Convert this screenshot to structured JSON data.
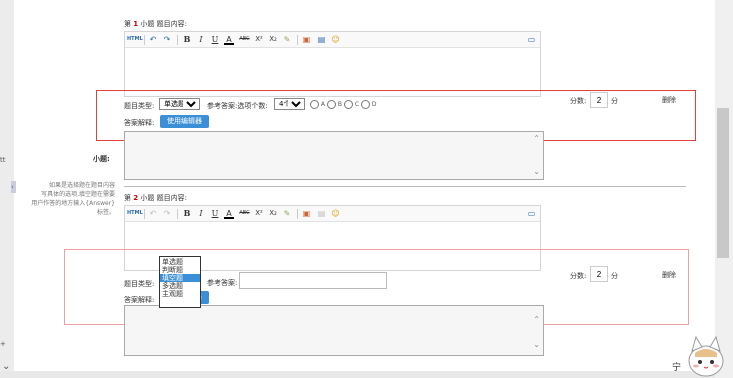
{
  "sidebar_stub": {
    "char1": "tt",
    "char2": "+",
    "expand_glyph": "‹",
    "scroll_glyph": "⌄"
  },
  "question1": {
    "header_prefix": "第",
    "header_num": "1",
    "header_suffix": "小题",
    "content_label": "题目内容:",
    "type_label": "题目类型:",
    "type_value": "单选题",
    "answer_label": "参考答案:选项个数:",
    "options_count": "4个",
    "options": [
      "A",
      "B",
      "C",
      "D"
    ],
    "score_label": "分数:",
    "score_value": "2",
    "score_unit": "分",
    "delete_label": "删除",
    "explain_label": "答案解释:",
    "editor_button": "使用编辑器",
    "subq_label": "小题:"
  },
  "hint_text": [
    "如果是选择题在题目内容",
    "写具体的选项,填空题在需要",
    "用户作答的地方输入{Answer}",
    "标签。"
  ],
  "question2": {
    "header_prefix": "第",
    "header_num": "2",
    "header_suffix": "小题",
    "content_label": "题目内容:",
    "type_label": "题目类型:",
    "answer_label": "参考答案:",
    "answer_value": "",
    "score_label": "分数:",
    "score_value": "2",
    "score_unit": "分",
    "delete_label": "删除",
    "explain_label": "答案解释:",
    "editor_button": "使用编辑器"
  },
  "dropdown": {
    "options": [
      "单选题",
      "判断题",
      "填空题",
      "多选题",
      "主观题"
    ],
    "selected": "填空题"
  },
  "toolbar": {
    "html": "HTML",
    "undo": "↶",
    "redo": "↷",
    "bold": "B",
    "italic": "I",
    "underline": "U",
    "font_color": "A",
    "strike": "ABC",
    "superscript": "X²",
    "subscript": "X₂",
    "eraser": "✎",
    "image": "▣",
    "media": "▤",
    "emoticon": "☺",
    "fullscreen": "▭"
  },
  "bottom_corner": {
    "glyph": "宁"
  },
  "colors": {
    "red_box": "#e04040",
    "pink_box": "#f0a0a0",
    "accent_blue": "#3a8fd6",
    "question_num": "#cc0000"
  }
}
